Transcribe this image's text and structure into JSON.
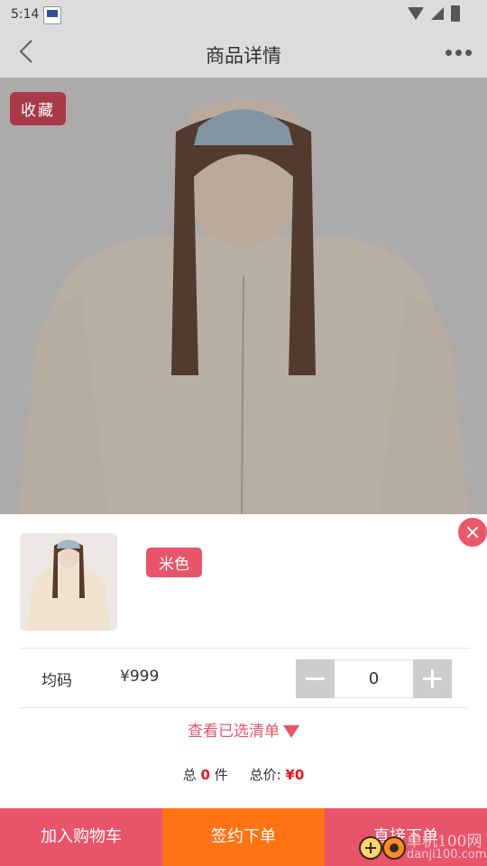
{
  "status_bar": {
    "time": "5:14"
  },
  "header": {
    "title": "商品详情",
    "back_icon": "chevron-left-icon",
    "more_icon": "more-horizontal-icon"
  },
  "product": {
    "favorite_label": "收藏"
  },
  "sheet": {
    "color_option": "米色",
    "size": "均码",
    "price": "¥999",
    "quantity": "0",
    "view_selected": "查看已选清单",
    "totals": {
      "count_prefix": "总",
      "count_value": "0",
      "count_unit": "件",
      "price_prefix": "总价:",
      "price_value": "¥0"
    }
  },
  "bottom_bar": {
    "add_to_cart": "加入购物车",
    "contract_order": "签约下单",
    "direct_order": "直接下单"
  },
  "watermark": {
    "text": "单机100网",
    "url": "danji100.com"
  },
  "colors": {
    "accent": "#e8546a",
    "orange": "#ff7314",
    "red_text": "#e8141e"
  }
}
